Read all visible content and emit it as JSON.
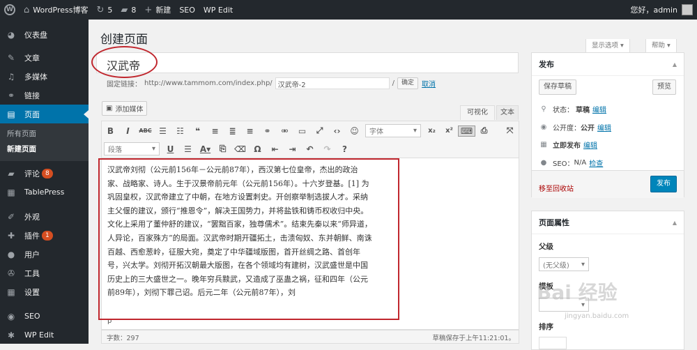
{
  "adminbar": {
    "site": "WordPress博客",
    "updates": "5",
    "comments": "8",
    "new": "新建",
    "seo": "SEO",
    "wpedit": "WP Edit",
    "greeting": "您好，admin"
  },
  "sidebar": {
    "items": [
      {
        "label": "仪表盘",
        "icon": "dashboard-icon",
        "glyph": "◕"
      },
      {
        "label": "文章",
        "icon": "pin-icon",
        "glyph": "✎"
      },
      {
        "label": "多媒体",
        "icon": "media-icon",
        "glyph": "♫"
      },
      {
        "label": "链接",
        "icon": "link-icon",
        "glyph": "⚭"
      },
      {
        "label": "页面",
        "icon": "page-icon",
        "glyph": "▤"
      }
    ],
    "submenu": [
      "所有页面",
      "新建页面"
    ],
    "items2": [
      {
        "label": "评论",
        "icon": "comment-icon",
        "glyph": "▰",
        "badge": "8"
      },
      {
        "label": "TablePress",
        "icon": "table-icon",
        "glyph": "▦"
      },
      {
        "label": "外观",
        "icon": "brush-icon",
        "glyph": "✐"
      },
      {
        "label": "插件",
        "icon": "plugin-icon",
        "glyph": "✚",
        "badge": "1"
      },
      {
        "label": "用户",
        "icon": "user-icon",
        "glyph": "●"
      },
      {
        "label": "工具",
        "icon": "wrench-icon",
        "glyph": "✇"
      },
      {
        "label": "设置",
        "icon": "settings-icon",
        "glyph": "▦"
      },
      {
        "label": "SEO",
        "icon": "seo-icon",
        "glyph": "◉"
      },
      {
        "label": "WP Edit",
        "icon": "gear-icon",
        "glyph": "✱"
      }
    ]
  },
  "header": {
    "title": "创建页面",
    "screen_options": "显示选项 ▾",
    "help": "帮助 ▾"
  },
  "editor": {
    "title_value": "汉武帝",
    "permalink_label": "固定链接：",
    "permalink_base": "http://www.tammom.com/index.php/",
    "slug_value": "汉武帝-2",
    "slug_suffix": "/",
    "ok": "确定",
    "cancel": "取消",
    "add_media": "添加媒体",
    "tab_visual": "可视化",
    "tab_text": "文本",
    "font_select": "字体",
    "format_select": "段落",
    "content": "汉武帝刘彻（公元前156年－公元前87年），西汉第七位皇帝，杰出的政治家、战略家、诗人。生于汉景帝前元年（公元前156年）。十六岁登基。[1] 为巩固皇权，汉武帝建立了中朝，在地方设置刺史。开创察举制选拔人才。采纳主父偃的建议，颁行“推恩令”，解决王国势力，并将盐铁和铸币权收归中央。文化上采用了董仲舒的建议，“罢黜百家，独尊儒术”。结束先秦以来“师异道，人异论，百家殊方”的局面。汉武帝时期开疆拓土，击溃匈奴、东并朝鲜、南诛百越、西愈葱岭，征服大宛，奠定了中华疆域版图，首开丝绸之路、首创年号，兴太学。刘彻开拓汉朝最大版图，在各个领域均有建树，汉武盛世是中国历史上的三大盛世之一。晚年穷兵黩武，又造成了巫蛊之祸，征和四年（公元前89年），刘彻下罪己诏。后元二年（公元前87年），刘",
    "path": "p",
    "word_count": "字数：297",
    "saved": "草稿保存于上午11:21:01。"
  },
  "publish": {
    "title": "发布",
    "save_draft": "保存草稿",
    "preview": "预览",
    "status_label": "状态：",
    "status_value": "草稿",
    "visibility_label": "公开度：",
    "visibility_value": "公开",
    "schedule": "立即发布",
    "seo_label": "SEO：",
    "seo_value": "N/A",
    "seo_check": "检查",
    "edit": "编辑",
    "trash": "移至回收站",
    "publish_btn": "发布"
  },
  "page_attributes": {
    "title": "页面属性",
    "parent_label": "父级",
    "parent_value": "(无父级)",
    "template_label": "模板",
    "order_label": "排序"
  },
  "watermark": {
    "text": "Bai 经验",
    "sub": "jingyan.baidu.com"
  }
}
